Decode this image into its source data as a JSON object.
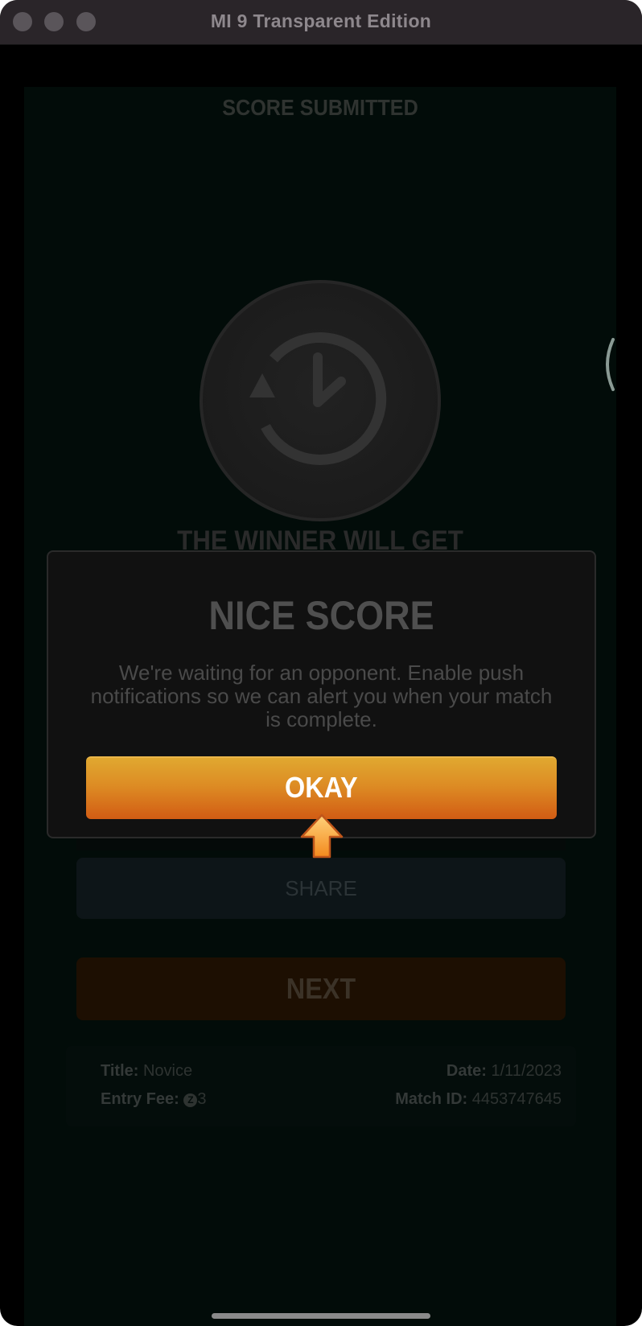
{
  "window": {
    "title": "MI 9 Transparent Edition"
  },
  "screen": {
    "title": "SCORE SUBMITTED",
    "winner_text": "THE WINNER WILL GET",
    "share_label": "SHARE",
    "next_label": "NEXT",
    "info": {
      "title_label": "Title:",
      "title_value": "Novice",
      "entry_fee_label": "Entry Fee:",
      "entry_fee_value": "3",
      "coin_symbol": "Z",
      "date_label": "Date:",
      "date_value": "1/11/2023",
      "match_id_label": "Match ID:",
      "match_id_value": "4453747645"
    }
  },
  "modal": {
    "title": "NICE SCORE",
    "body": "We're waiting for an opponent. Enable push notifications so we can alert you when your match is complete.",
    "okay_label": "OKAY"
  },
  "colors": {
    "okay_gradient_top": "#e0a830",
    "okay_gradient_bottom": "#d25c14",
    "pointer_arrow": "#f6a43c"
  },
  "icons": {
    "clock": "clock-history-icon",
    "pointer": "pointer-arrow-icon"
  }
}
